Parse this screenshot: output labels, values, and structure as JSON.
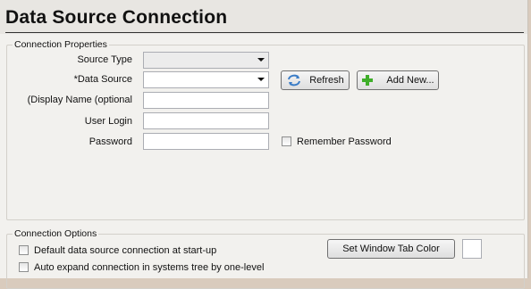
{
  "window": {
    "title": "Data Source Connection"
  },
  "connection_properties": {
    "legend": "Connection Properties",
    "source_type": {
      "label": "Source Type",
      "value": ""
    },
    "data_source": {
      "label": "*Data Source",
      "value": ""
    },
    "display_name": {
      "label": "(Display Name (optional",
      "value": ""
    },
    "user_login": {
      "label": "User Login",
      "value": ""
    },
    "password": {
      "label": "Password",
      "value": ""
    },
    "refresh_button": {
      "label": "Refresh",
      "icon": "refresh-icon"
    },
    "add_new_button": {
      "label": "Add New...",
      "icon": "green-plus-icon"
    },
    "remember_password": {
      "label": "Remember Password",
      "checked": false
    }
  },
  "connection_options": {
    "legend": "Connection Options",
    "default_at_startup": {
      "label": "Default data source connection at start-up",
      "checked": false
    },
    "auto_expand": {
      "label": "Auto expand connection in systems tree by one-level",
      "checked": false
    },
    "set_tab_color_button": {
      "label": "Set Window Tab Color"
    }
  },
  "colors": {
    "window_bg": "#f2f1ee",
    "title_bg": "#e8e6e2",
    "add_icon": "#3fae2a",
    "refresh_icon": "#3a7cc6"
  }
}
